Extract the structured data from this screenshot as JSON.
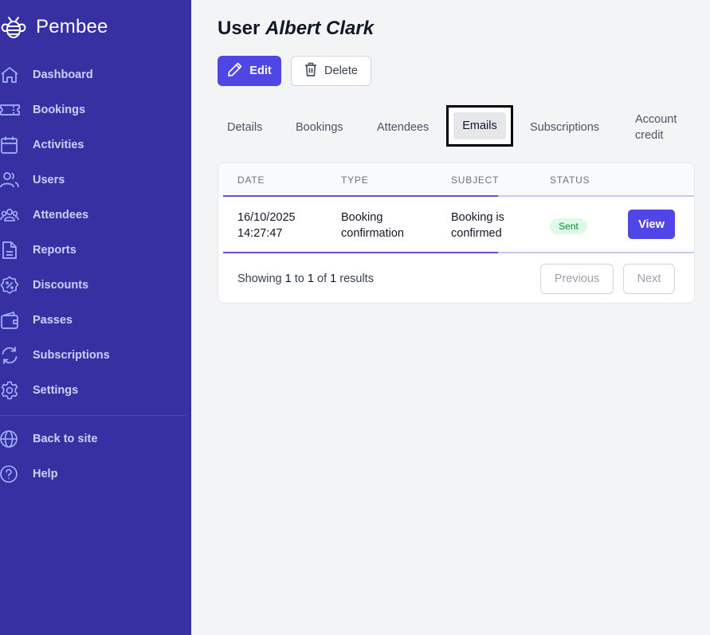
{
  "brand": {
    "name": "Pembee"
  },
  "sidebar": {
    "items": [
      {
        "label": "Dashboard",
        "icon": "home-icon"
      },
      {
        "label": "Bookings",
        "icon": "ticket-icon"
      },
      {
        "label": "Activities",
        "icon": "calendar-icon"
      },
      {
        "label": "Users",
        "icon": "users-icon"
      },
      {
        "label": "Attendees",
        "icon": "user-group-icon"
      },
      {
        "label": "Reports",
        "icon": "document-icon"
      },
      {
        "label": "Discounts",
        "icon": "percent-badge-icon"
      },
      {
        "label": "Passes",
        "icon": "wallet-icon"
      },
      {
        "label": "Subscriptions",
        "icon": "refresh-icon"
      },
      {
        "label": "Settings",
        "icon": "gear-icon"
      }
    ],
    "footer_items": [
      {
        "label": "Back to site",
        "icon": "globe-icon"
      },
      {
        "label": "Help",
        "icon": "question-icon"
      }
    ]
  },
  "page": {
    "title_prefix": "User",
    "title_name": "Albert Clark"
  },
  "actions": {
    "edit_label": "Edit",
    "delete_label": "Delete"
  },
  "tabs": {
    "details": "Details",
    "bookings": "Bookings",
    "attendees": "Attendees",
    "emails": "Emails",
    "subscriptions": "Subscriptions",
    "account_credit_line1": "Account",
    "account_credit_line2": "credit",
    "active": "Emails"
  },
  "table": {
    "headers": {
      "date": "DATE",
      "type": "TYPE",
      "subject": "SUBJECT",
      "status": "STATUS"
    },
    "rows": [
      {
        "date_line1": "16/10/2025",
        "date_line2": "14:27:47",
        "type_line1": "Booking",
        "type_line2": "confirmation",
        "subject_line1": "Booking is",
        "subject_line2": "confirmed",
        "status": "Sent",
        "action": "View"
      }
    ],
    "footer": {
      "showing": "Showing",
      "from": "1",
      "to_word": "to",
      "to": "1",
      "of_word": "of",
      "total": "1",
      "results_word": "results"
    },
    "pager": {
      "previous": "Previous",
      "next": "Next"
    }
  },
  "colors": {
    "sidebar_bg": "#3730a3",
    "sidebar_text": "#c7d2fe",
    "primary": "#4f46e5",
    "status_sent_bg": "#dcfce7",
    "status_sent_text": "#15803d"
  }
}
